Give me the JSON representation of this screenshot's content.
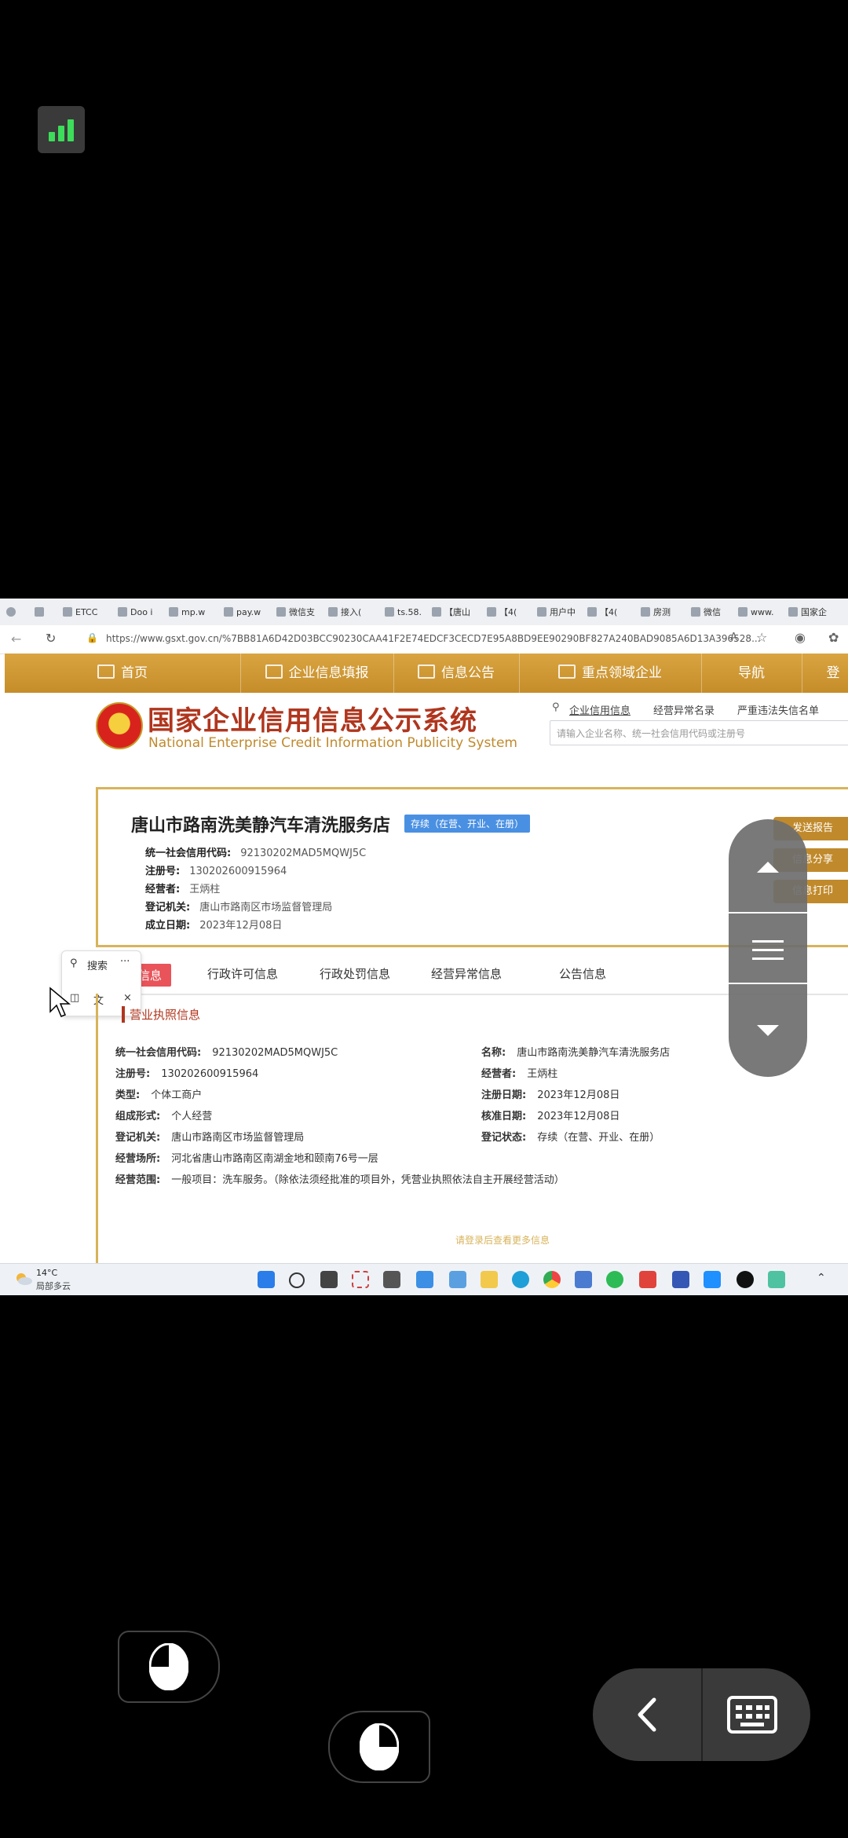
{
  "browser": {
    "tabs": [
      "ETCC",
      "Doo i",
      "mp.w",
      "pay.w",
      "微信支",
      "接入(",
      "ts.58.",
      "【唐山",
      "【4(",
      "用户中",
      "【4(",
      "房测",
      "微信",
      "www.",
      "国家企"
    ],
    "url": "https://www.gsxt.gov.cn/%7BB81A6D42D03BCC90230CAA41F2E74EDCF3CECD7E95A8BD9EE90290BF827A240BAD9085A6D13A396528..."
  },
  "nav": {
    "items": [
      "首页",
      "企业信息填报",
      "信息公告",
      "重点领域企业",
      "导航",
      "登"
    ]
  },
  "header": {
    "title": "国家企业信用信息公示系统",
    "subtitle": "National Enterprise Credit Information Publicity System",
    "search_tabs": [
      "企业信用信息",
      "经营异常名录",
      "严重违法失信名单"
    ],
    "search_placeholder": "请输入企业名称、统一社会信用代码或注册号"
  },
  "company": {
    "name": "唐山市路南洗美静汽车清洗服务店",
    "status": "存续（在营、开业、在册）",
    "fields": [
      {
        "k": "统一社会信用代码:",
        "v": "92130202MAD5MQWJ5C"
      },
      {
        "k": "注册号:",
        "v": "130202600915964"
      },
      {
        "k": "经营者:",
        "v": "王炳柱"
      },
      {
        "k": "登记机关:",
        "v": "唐山市路南区市场监督管理局"
      },
      {
        "k": "成立日期:",
        "v": "2023年12月08日"
      }
    ],
    "side_buttons": [
      "发送报告",
      "信息分享",
      "信息打印"
    ]
  },
  "mini_toolbar": {
    "search": "搜索",
    "more": "···"
  },
  "content_tabs": [
    "基础信息",
    "行政许可信息",
    "行政处罚信息",
    "经营异常信息",
    "公告信息"
  ],
  "license": {
    "title": "营业执照信息",
    "left": [
      {
        "k": "统一社会信用代码:",
        "v": "92130202MAD5MQWJ5C"
      },
      {
        "k": "注册号:",
        "v": "130202600915964"
      },
      {
        "k": "类型:",
        "v": "个体工商户"
      },
      {
        "k": "组成形式:",
        "v": "个人经营"
      },
      {
        "k": "登记机关:",
        "v": "唐山市路南区市场监督管理局"
      },
      {
        "k": "经营场所:",
        "v": "河北省唐山市路南区南湖金地和颐南76号一层"
      },
      {
        "k": "经营范围:",
        "v": "一般项目：洗车服务。（除依法须经批准的项目外，凭营业执照依法自主开展经营活动）"
      }
    ],
    "right": [
      {
        "k": "名称:",
        "v": "唐山市路南洗美静汽车清洗服务店"
      },
      {
        "k": "经营者:",
        "v": "王炳柱"
      },
      {
        "k": "注册日期:",
        "v": "2023年12月08日"
      },
      {
        "k": "核准日期:",
        "v": "2023年12月08日"
      },
      {
        "k": "登记状态:",
        "v": "存续（在营、开业、在册）"
      }
    ],
    "more": "请登录后查看更多信息"
  },
  "taskbar": {
    "temp": "14°C",
    "weather": "局部多云"
  },
  "colors": {
    "gold": "#c58d2a",
    "title_red": "#b0361e",
    "badge_blue": "#4a90e2",
    "tab_red": "#e8545a"
  }
}
